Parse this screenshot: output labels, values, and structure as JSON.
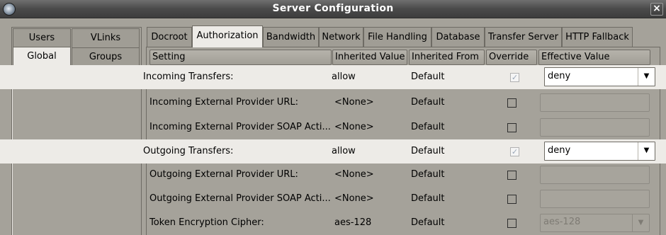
{
  "window": {
    "title": "Server Configuration"
  },
  "left_tabs": [
    "Users",
    "VLinks",
    "Global",
    "Groups"
  ],
  "tabs": [
    "Docroot",
    "Authorization",
    "Bandwidth",
    "Network",
    "File Handling",
    "Database",
    "Transfer Server",
    "HTTP Fallback"
  ],
  "active_tab": "Authorization",
  "columns": [
    "Setting",
    "Inherited Value",
    "Inherited From",
    "Override",
    "Effective Value"
  ],
  "rows": [
    {
      "setting": "Incoming Transfers:",
      "inherited_value": "allow",
      "inherited_from": "Default",
      "override": true,
      "effective_value": "deny"
    },
    {
      "setting": "Incoming External Provider URL:",
      "inherited_value": "<None>",
      "inherited_from": "Default",
      "override": false,
      "effective_value": ""
    },
    {
      "setting": "Incoming External Provider SOAP Acti...",
      "inherited_value": "<None>",
      "inherited_from": "Default",
      "override": false,
      "effective_value": ""
    },
    {
      "setting": "Outgoing Transfers:",
      "inherited_value": "allow",
      "inherited_from": "Default",
      "override": true,
      "effective_value": "deny"
    },
    {
      "setting": "Outgoing External Provider URL:",
      "inherited_value": "<None>",
      "inherited_from": "Default",
      "override": false,
      "effective_value": ""
    },
    {
      "setting": "Outgoing External Provider SOAP Acti...",
      "inherited_value": "<None>",
      "inherited_from": "Default",
      "override": false,
      "effective_value": ""
    },
    {
      "setting": "Token Encryption Cipher:",
      "inherited_value": "aes-128",
      "inherited_from": "Default",
      "override": false,
      "effective_value": "aes-128"
    }
  ],
  "icons": {
    "app": "app-icon",
    "close": "close-icon",
    "dropdown": "chevron-down-icon",
    "check": "checkmark-icon"
  },
  "check_mark": "✓",
  "arrow_glyph": "▼",
  "close_glyph": "×"
}
